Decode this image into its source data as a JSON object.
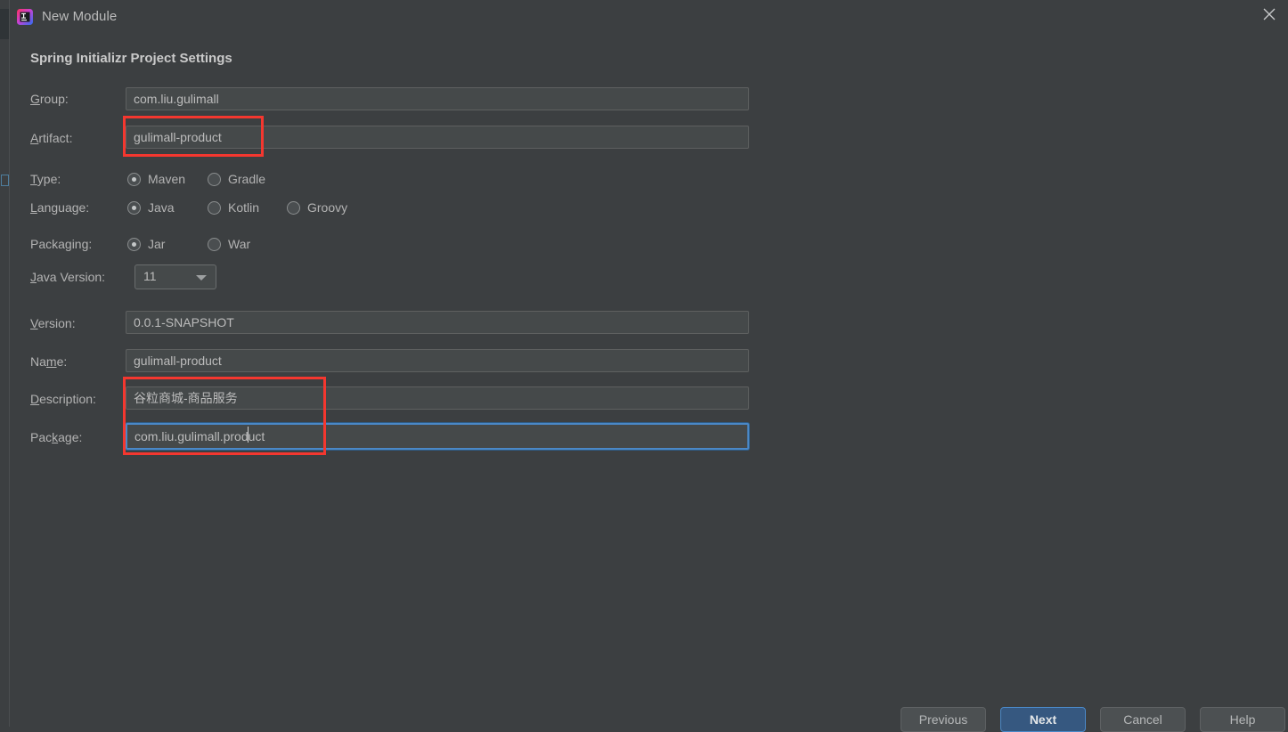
{
  "window": {
    "title": "New Module",
    "app_icon": "intellij-idea-icon",
    "close_icon": "close-icon"
  },
  "section": {
    "heading": "Spring Initializr Project Settings"
  },
  "form": {
    "group": {
      "label": "Group:",
      "mnemonic": "G",
      "value": "com.liu.gulimall"
    },
    "artifact": {
      "label": "Artifact:",
      "mnemonic": "A",
      "value": "gulimall-product"
    },
    "type": {
      "label": "Type:",
      "mnemonic": "T",
      "options": [
        "Maven",
        "Gradle"
      ],
      "selected": "Maven"
    },
    "language": {
      "label": "Language:",
      "mnemonic": "L",
      "options": [
        "Java",
        "Kotlin",
        "Groovy"
      ],
      "selected": "Java"
    },
    "packaging": {
      "label": "Packaging:",
      "mnemonic": "",
      "options": [
        "Jar",
        "War"
      ],
      "selected": "Jar"
    },
    "java_version": {
      "label": "Java Version:",
      "mnemonic": "J",
      "value": "11",
      "arrow_icon": "chevron-down-icon"
    },
    "version": {
      "label": "Version:",
      "mnemonic": "V",
      "value": "0.0.1-SNAPSHOT"
    },
    "name": {
      "label": "Name:",
      "mnemonic": "m",
      "value": "gulimall-product"
    },
    "description": {
      "label": "Description:",
      "mnemonic": "D",
      "value": "谷粒商城-商品服务"
    },
    "package": {
      "label": "Package:",
      "mnemonic": "k",
      "value": "com.liu.gulimall.product",
      "focused": true
    }
  },
  "annotations": {
    "color": "#f4372f",
    "boxes": [
      "artifact-field-highlight",
      "description-package-highlight"
    ]
  },
  "footer": {
    "previous_label": "Previous",
    "next_label": "Next",
    "cancel_label": "Cancel",
    "help_label": "Help"
  },
  "colors": {
    "dialog_background": "#3c3f41",
    "field_background": "#45494a",
    "text": "#b3b3b3",
    "accent_blue": "#4a88c7",
    "primary_button": "#365880",
    "annotation_red": "#f4372f"
  }
}
